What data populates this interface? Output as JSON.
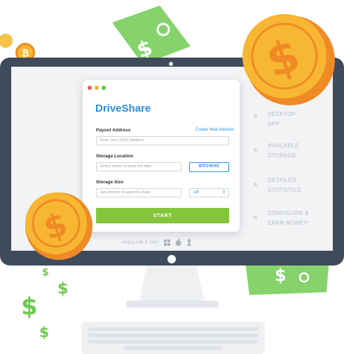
{
  "app": {
    "title": "DriveShare",
    "payout": {
      "label": "Payout Address",
      "link": "Create New Address",
      "placeholder": "Enter your SJCX Address"
    },
    "storage_location": {
      "label": "Storage Location",
      "placeholder": "Select where to keep the data",
      "browse_label": "BROWSE"
    },
    "storage_size": {
      "label": "Storage Size",
      "placeholder": "Set amount of space to share",
      "unit": "GB"
    },
    "start_label": "START"
  },
  "available_on": "AVAILABLE ON*",
  "platform_icons": [
    "windows-icon",
    "apple-icon",
    "linux-icon"
  ],
  "features": [
    {
      "line1": "DESKTOP",
      "line2": "APP"
    },
    {
      "line1": "AVAILABLE",
      "line2": "STORAGE"
    },
    {
      "line1": "DETAILED",
      "line2": "STATISTICS"
    },
    {
      "line1": "CONFIGURE &",
      "line2": "EARN MONEY!"
    }
  ],
  "colors": {
    "accent": "#2d8ee6",
    "start": "#84c53c",
    "monitor": "#3f4a5a",
    "coin": "#f7b733",
    "coin_edge": "#f08a24",
    "cash": "#86d36c"
  }
}
